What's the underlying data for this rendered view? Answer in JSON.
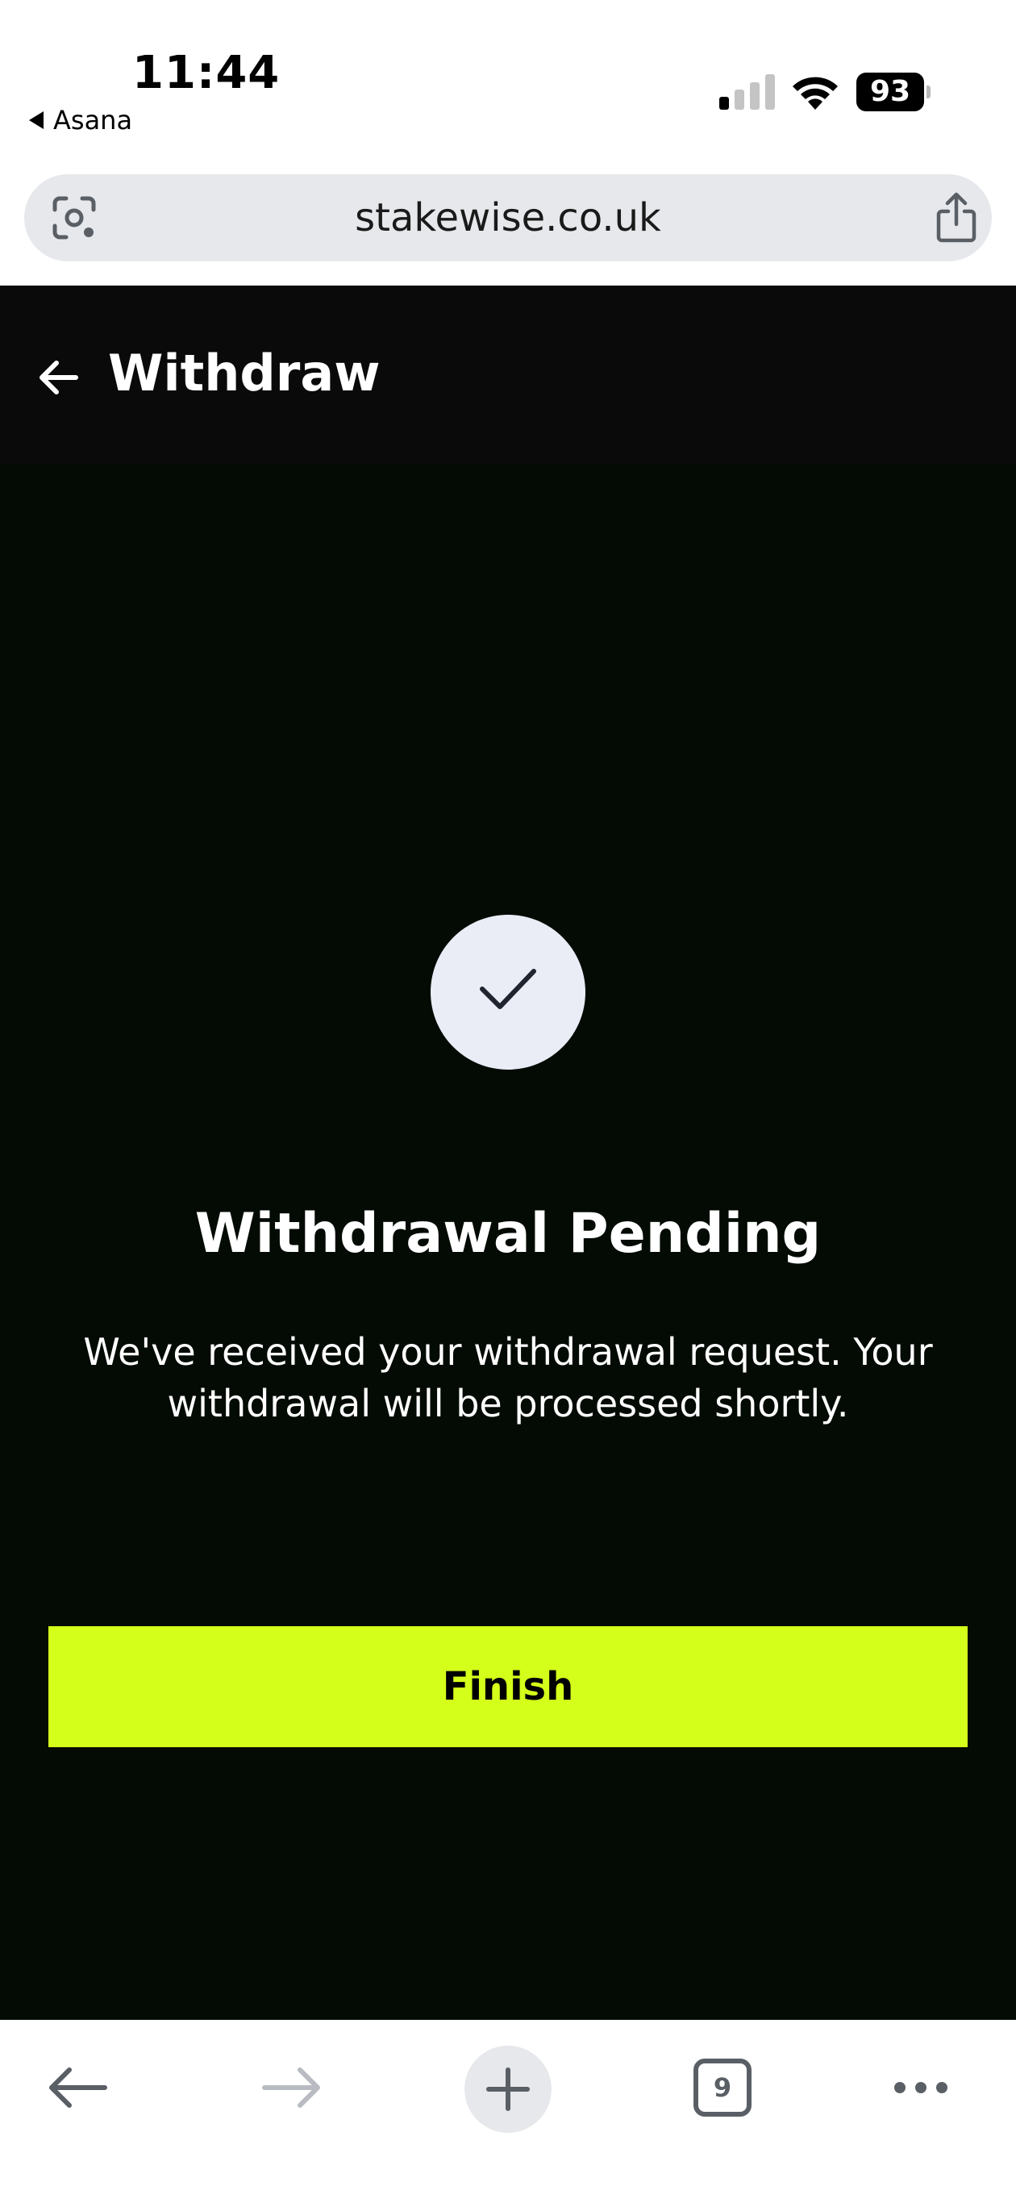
{
  "status_bar": {
    "time": "11:44",
    "back_app": "Asana",
    "battery": "93"
  },
  "browser": {
    "url": "stakewise.co.uk",
    "tab_count": "9"
  },
  "header": {
    "title": "Withdraw"
  },
  "result": {
    "title": "Withdrawal Pending",
    "description": "We've received your withdrawal request. Your withdrawal will be processed shortly."
  },
  "actions": {
    "finish_label": "Finish"
  },
  "colors": {
    "accent": "#d4ff1a",
    "background": "#030b04",
    "header_bg": "#0a0a0a"
  }
}
